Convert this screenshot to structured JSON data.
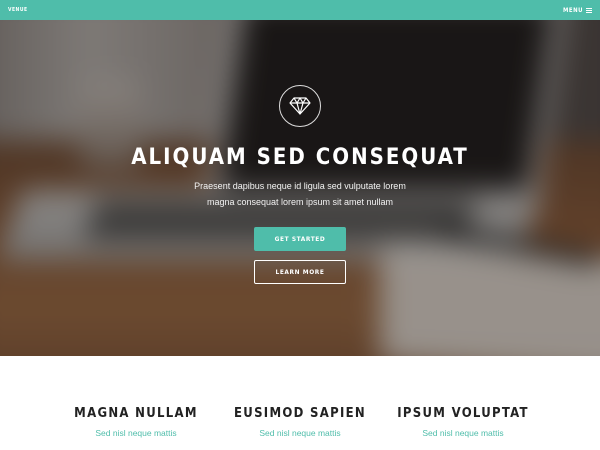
{
  "topbar": {
    "brand": "VENUE",
    "menu_label": "MENU",
    "menu_icon": "hamburger-icon",
    "background_color": "#4fbdaa"
  },
  "hero": {
    "icon": "diamond-icon",
    "title": "ALIQUAM SED CONSEQUAT",
    "text_line1": "Praesent dapibus neque id ligula sed vulputate lorem",
    "text_line2": "magna consequat lorem ipsum sit amet nullam",
    "primary_button": "GET STARTED",
    "secondary_button": "LEARN MORE",
    "accent_color": "#4fbdaa"
  },
  "features": [
    {
      "title": "MAGNA NULLAM",
      "subtitle": "Sed nisl neque mattis"
    },
    {
      "title": "EUSIMOD SAPIEN",
      "subtitle": "Sed nisl neque mattis"
    },
    {
      "title": "IPSUM VOLUPTAT",
      "subtitle": "Sed nisl neque mattis"
    }
  ]
}
